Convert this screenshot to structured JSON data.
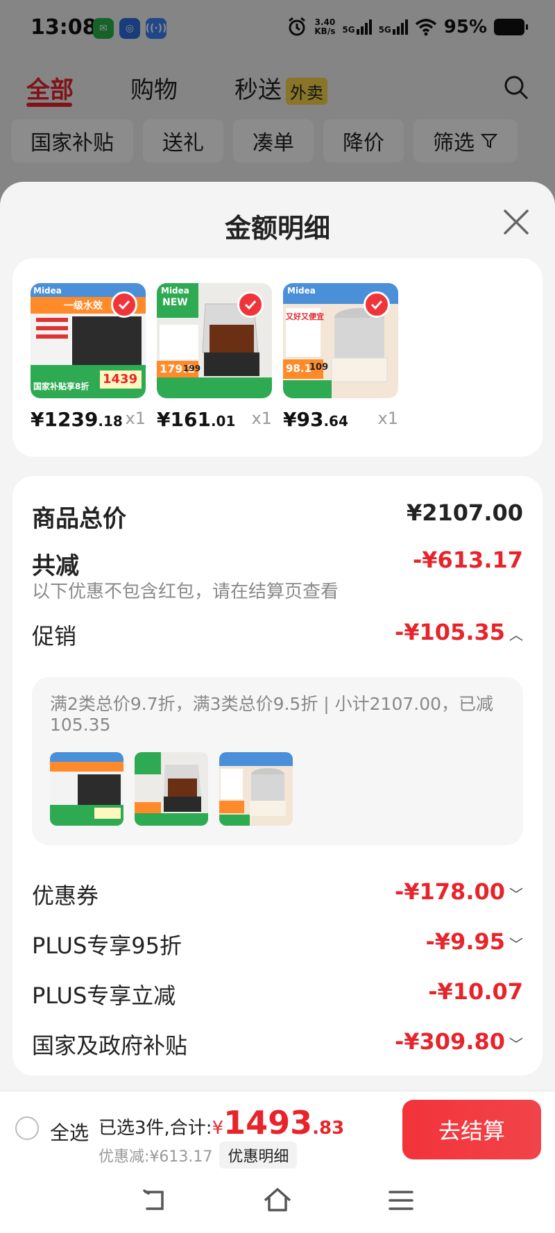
{
  "status": {
    "time": "13:08",
    "speed": "3.40\nKB/s",
    "speed_top": "3.40",
    "speed_bottom": "KB/s",
    "net1": "5G",
    "net2": "5G",
    "battery": "95%"
  },
  "nav": {
    "tabs": [
      "全部",
      "购物",
      "秒送"
    ],
    "tag": "外卖",
    "chips": [
      "国家补贴",
      "送礼",
      "凑单",
      "降价",
      "筛选"
    ]
  },
  "sheet": {
    "title": "金额明细"
  },
  "products": [
    {
      "price_int": "¥1239",
      "price_dec": ".18",
      "qty": "x1",
      "badge": "Midea",
      "img_text1": "一级水效",
      "img_text2": "国家补贴享8折",
      "img_price": "1439"
    },
    {
      "price_int": "¥161",
      "price_dec": ".01",
      "qty": "x1",
      "badge": "Midea",
      "img_text1": "NEW",
      "img_text2": "179.1",
      "img_price": "199"
    },
    {
      "price_int": "¥93",
      "price_dec": ".64",
      "qty": "x1",
      "badge": "Midea",
      "img_text1": "又好又便宜",
      "img_text2": "98.1",
      "img_price": "109"
    }
  ],
  "details": {
    "total_label": "商品总价",
    "total_value": "¥2107.00",
    "reduce_label": "共减",
    "reduce_value": "-¥613.17",
    "reduce_note": "以下优惠不包含红包，请在结算页查看",
    "promo_label": "促销",
    "promo_value": "-¥105.35",
    "promo_desc": "满2类总价9.7折，满3类总价9.5折 | 小计2107.00，已减105.35",
    "coupon_label": "优惠券",
    "coupon_value": "-¥178.00",
    "plus95_label": "PLUS专享95折",
    "plus95_value": "-¥9.95",
    "plusoff_label": "PLUS专享立减",
    "plusoff_value": "-¥10.07",
    "subsidy_label": "国家及政府补贴",
    "subsidy_value": "-¥309.80"
  },
  "bottom": {
    "select_all": "全选",
    "summary_prefix": "已选3件,合计:",
    "currency": "¥",
    "total_int": "1493",
    "total_dec": ".83",
    "discount_text": "优惠减:¥613.17",
    "detail_button": "优惠明细",
    "checkout": "去结算"
  },
  "colors": {
    "accent_red": "#e8242b",
    "checkout_red": "#f2333a"
  }
}
